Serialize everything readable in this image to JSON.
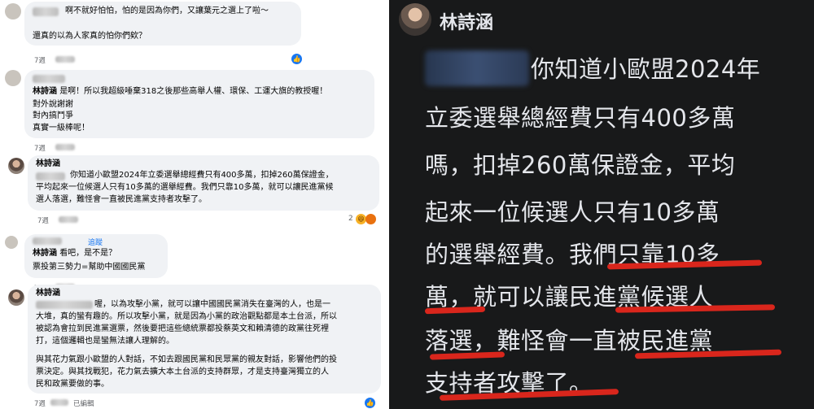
{
  "comments": [
    {
      "text": "啊不就好怕怕，怕的是因為你們，又讓葉元之選上了啦～",
      "text2": "還真的以為人家真的怕你們欸？",
      "time": "7週"
    },
    {
      "name": "林詩涵",
      "line1": "是啊！所以我超級唾棄318之後那些高舉人權、環保、工運大旗的教授喔！",
      "line2": "對外說謝謝",
      "line3": "對內搞鬥爭",
      "line4": "真實一級棒呢！",
      "time": "7週",
      "reply": "回覆"
    },
    {
      "name": "林詩涵",
      "line1": "你知道小歐盟2024年立委選舉總經費只有400多萬，扣掉260萬保證金，",
      "line2": "平均起來一位候選人只有10多萬的選舉經費。我們只靠10多萬，就可以讓民進黨候",
      "line3": "選人落選，難怪會一直被民進黨支持者攻擊了。",
      "time": "7週",
      "reply": "回覆",
      "reactions": "2"
    },
    {
      "name": "林詩涵",
      "line1": "看吧，是不是？",
      "line2": "票投第三勢力=幫助中國國民黨",
      "time": "7週",
      "reply": "回覆",
      "follow": "追蹤"
    },
    {
      "name": "林詩涵",
      "line1": "喔，以為攻擊小黨，就可以讓中國國民黨消失在臺灣的人，也是一",
      "line2": "大堆，真的蠻有趣的。所以攻擊小黨，就是因為小黨的政治觀點都是本土台派，所以",
      "line3": "被認為會拉到民進黨選票，然後要把這些總統票都投蔡英文和賴清德的政黨往死裡",
      "line4": "打，這個邏輯也是蠻無法讓人理解的。",
      "line5": "與其花力氣跟小歐盟的人對話，不如去跟國民黨和民眾黨的親友對話，影響他們的投",
      "line6": "票決定。與其找戰犯，花力氣去擴大本土台派的支持群眾，才是支持臺灣獨立的人",
      "line7": "民和政黨要做的事。",
      "time": "7週",
      "reply": "回覆",
      "edited": "已編輯"
    }
  ],
  "zoom": {
    "name": "林詩涵",
    "lines": [
      "你知道小歐盟2024年",
      "立委選舉總經費只有400多萬",
      "嗎，扣掉260萬保證金，平均",
      "起來一位候選人只有10多萬",
      "的選舉經費。我們只靠10多",
      "萬，就可以讓民進黨候選人",
      "落選，難怪會一直被民進黨",
      "支持者攻擊了。"
    ]
  },
  "colors": {
    "accent": "#1877f2",
    "dark_bg": "#18191a",
    "underline": "#d9261c",
    "bubble": "#f0f2f5"
  }
}
